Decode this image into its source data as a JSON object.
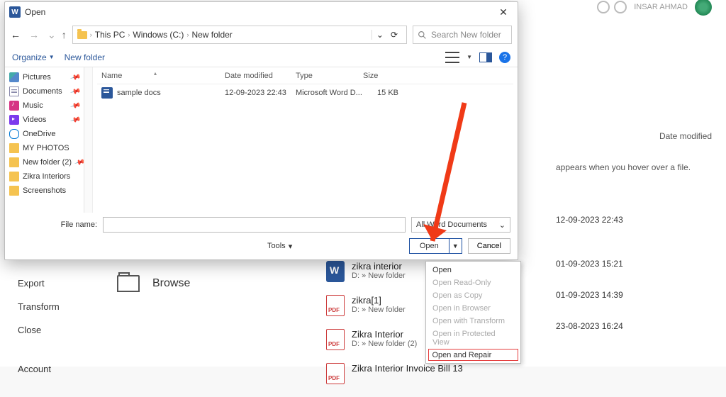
{
  "dialog": {
    "title": "Open",
    "close_glyph": "✕",
    "nav": {
      "back": "←",
      "fwd": "→",
      "dropdown": "⌄",
      "up": "↑"
    },
    "address": {
      "seg1": "This PC",
      "seg2": "Windows (C:)",
      "seg3": "New folder"
    },
    "search_placeholder": "Search New folder",
    "refresh_glyph": "⟳",
    "addr_dd_glyph": "⌄",
    "toolbar": {
      "organize": "Organize",
      "newfolder": "New folder",
      "help": "?"
    },
    "columns": {
      "name": "Name",
      "date": "Date modified",
      "type": "Type",
      "size": "Size"
    },
    "sidebar": [
      {
        "label": "Pictures",
        "ic": "pic",
        "pinned": true
      },
      {
        "label": "Documents",
        "ic": "doc",
        "pinned": true
      },
      {
        "label": "Music",
        "ic": "mus",
        "pinned": true
      },
      {
        "label": "Videos",
        "ic": "vid",
        "pinned": true
      },
      {
        "label": "OneDrive",
        "ic": "cloud",
        "pinned": false
      },
      {
        "label": "MY PHOTOS",
        "ic": "fold y",
        "pinned": false
      },
      {
        "label": "New folder (2)",
        "ic": "fold y",
        "pinned": true
      },
      {
        "label": "Zikra Interiors",
        "ic": "fold y",
        "pinned": false
      },
      {
        "label": "Screenshots",
        "ic": "fold y",
        "pinned": false
      }
    ],
    "files": [
      {
        "name": "sample docs",
        "date": "12-09-2023 22:43",
        "type": "Microsoft Word D...",
        "size": "15 KB"
      }
    ],
    "filename_label": "File name:",
    "filter_label": "All Word Documents",
    "filter_caret": "⌄",
    "tools_label": "Tools",
    "tools_caret": "▾",
    "open_label": "Open",
    "open_caret": "▼",
    "cancel_label": "Cancel"
  },
  "dropdown": {
    "items": [
      {
        "label": "Open",
        "disabled": false
      },
      {
        "label": "Open Read-Only",
        "disabled": true
      },
      {
        "label": "Open as Copy",
        "disabled": true
      },
      {
        "label": "Open in Browser",
        "disabled": true
      },
      {
        "label": "Open with Transform",
        "disabled": true
      },
      {
        "label": "Open in Protected View",
        "disabled": true
      },
      {
        "label": "Open and Repair",
        "disabled": false,
        "highlight": true
      }
    ]
  },
  "background": {
    "user": "INSAR AHMAD",
    "col_date": "Date modified",
    "hover_hint": "appears when you hover over a file.",
    "dates": [
      "12-09-2023 22:43",
      "01-09-2023 15:21",
      "01-09-2023 14:39",
      "23-08-2023 16:24"
    ],
    "files": [
      {
        "name": "zikra interior",
        "path": "D: » New folder",
        "kind": "word"
      },
      {
        "name": "zikra[1]",
        "path": "D: » New folder",
        "kind": "pdf"
      },
      {
        "name": "Zikra Interior",
        "path": "D: » New folder (2)",
        "kind": "pdf"
      },
      {
        "name": "Zikra Interior Invoice Bill 13",
        "path": "",
        "kind": "pdf"
      }
    ],
    "left_items": [
      "Export",
      "Transform",
      "Close",
      "Account"
    ],
    "browse_label": "Browse"
  }
}
